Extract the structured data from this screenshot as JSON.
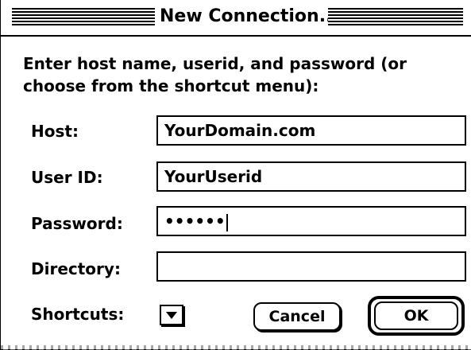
{
  "window": {
    "title": "New Connection..."
  },
  "instructions": "Enter host name, userid, and password (or choose from the shortcut menu):",
  "form": {
    "host": {
      "label": "Host:",
      "value": "YourDomain.com"
    },
    "userid": {
      "label": "User ID:",
      "value": "YourUserid"
    },
    "password": {
      "label": "Password:",
      "value": "••••••"
    },
    "directory": {
      "label": "Directory:",
      "value": ""
    },
    "shortcuts": {
      "label": "Shortcuts:",
      "icon": "chevron-down-icon"
    }
  },
  "buttons": {
    "cancel": "Cancel",
    "ok": "OK"
  },
  "colors": {
    "foreground": "#000000",
    "background": "#ffffff"
  }
}
